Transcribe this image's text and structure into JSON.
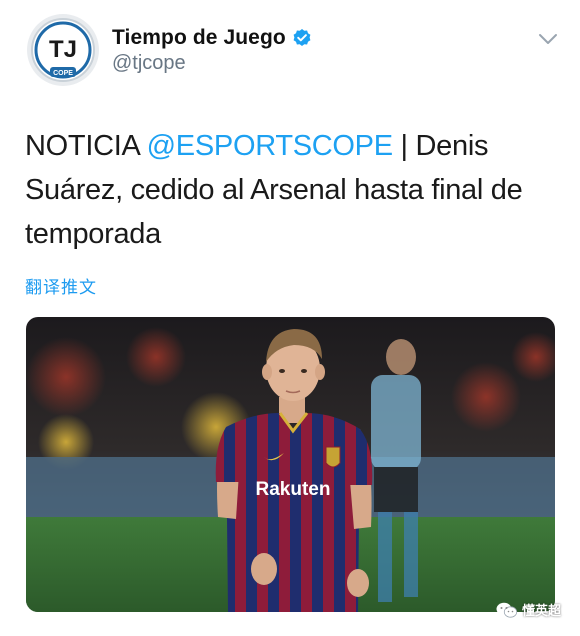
{
  "account": {
    "display_name": "Tiempo de Juego",
    "handle": "@tjcope",
    "avatar_initials": "TJ",
    "avatar_sub": "COPE",
    "verified": true
  },
  "tweet": {
    "text_prefix": "NOTICIA ",
    "mention": "@ESPORTSCOPE",
    "text_suffix": " | Denis Suárez, cedido al Arsenal hasta final de temporada",
    "translate_label": "翻译推文"
  },
  "photo": {
    "jersey_sponsor": "Rakuten",
    "jersey_brand_icon": "nike-swoosh-icon"
  },
  "watermark": {
    "text": "懂英超"
  },
  "colors": {
    "link": "#1da1f2",
    "handle_gray": "#687684",
    "verified_blue": "#1da1f2",
    "chevron_gray": "#9aa5b0"
  }
}
